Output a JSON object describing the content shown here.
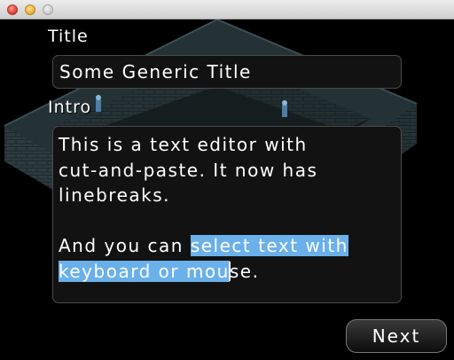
{
  "window": {
    "controls": [
      "close",
      "minimize",
      "zoom"
    ]
  },
  "form": {
    "title_label": "Title",
    "title_value": "Some Generic Title",
    "intro_label": "Intro",
    "intro_text": {
      "before_selection": "This is a text editor with\ncut-and-paste. It now has\nlinebreaks.\n\nAnd you can ",
      "selected": [
        "select text with",
        "keyboard or mou"
      ],
      "after_caret": "se."
    }
  },
  "actions": {
    "next_label": "Next"
  },
  "colors": {
    "selection": "#6ab0ea",
    "wall": "#2f4146",
    "floor": "#1a2424"
  }
}
